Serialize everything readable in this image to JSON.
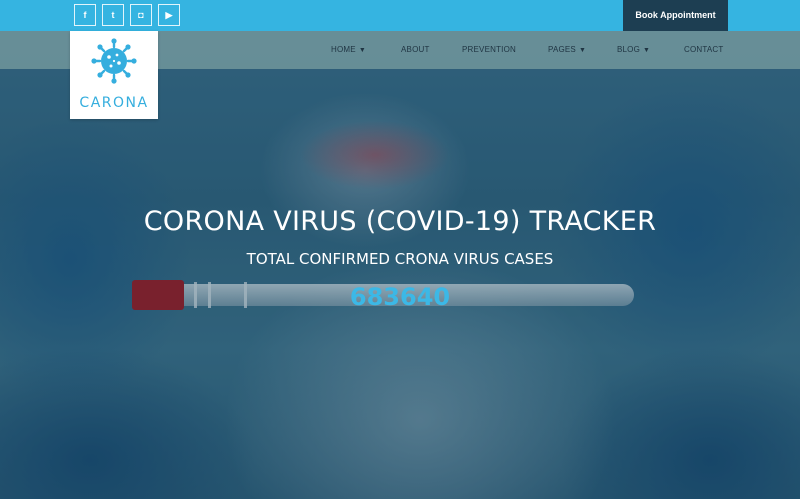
{
  "topbar": {
    "social_icons": [
      {
        "name": "facebook-icon",
        "glyph": "f"
      },
      {
        "name": "twitter-icon",
        "glyph": "t"
      },
      {
        "name": "instagram-icon",
        "glyph": "◘"
      },
      {
        "name": "youtube-icon",
        "glyph": "▶"
      }
    ],
    "book_label": "Book Appointment",
    "bar_color": "#35b4e1",
    "book_bg": "#1d3e52"
  },
  "logo": {
    "text": "CARONA",
    "color": "#35aede",
    "icon": "virus-icon"
  },
  "nav": {
    "items": [
      {
        "label": "HOME",
        "dropdown": true
      },
      {
        "label": "ABOUT",
        "dropdown": false
      },
      {
        "label": "PREVENTION",
        "dropdown": false
      },
      {
        "label": "PAGES",
        "dropdown": true
      },
      {
        "label": "BLOG",
        "dropdown": true
      },
      {
        "label": "CONTACT",
        "dropdown": false
      }
    ],
    "chevron": "▼"
  },
  "hero": {
    "title": "CORONA VIRUS (COVID-19) TRACKER",
    "subtitle": "TOTAL CONFIRMED CRONA VIRUS CASES",
    "count": "683640",
    "count_color": "#3cb8e6"
  }
}
